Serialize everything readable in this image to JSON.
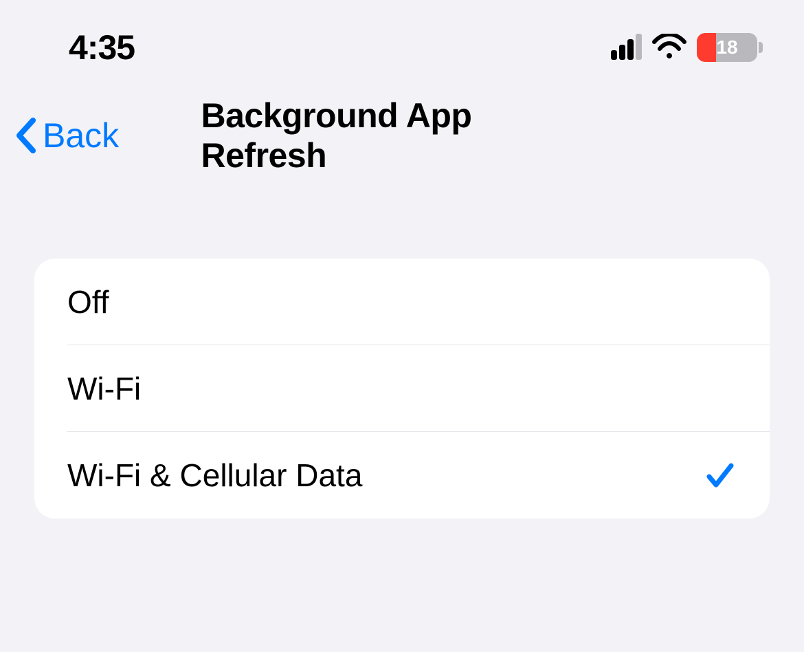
{
  "status_bar": {
    "time": "4:35",
    "battery_level": "18"
  },
  "nav": {
    "back_label": "Back",
    "title": "Background App Refresh"
  },
  "options": {
    "items": [
      {
        "label": "Off",
        "selected": false
      },
      {
        "label": "Wi-Fi",
        "selected": false
      },
      {
        "label": "Wi-Fi & Cellular Data",
        "selected": true
      }
    ]
  }
}
